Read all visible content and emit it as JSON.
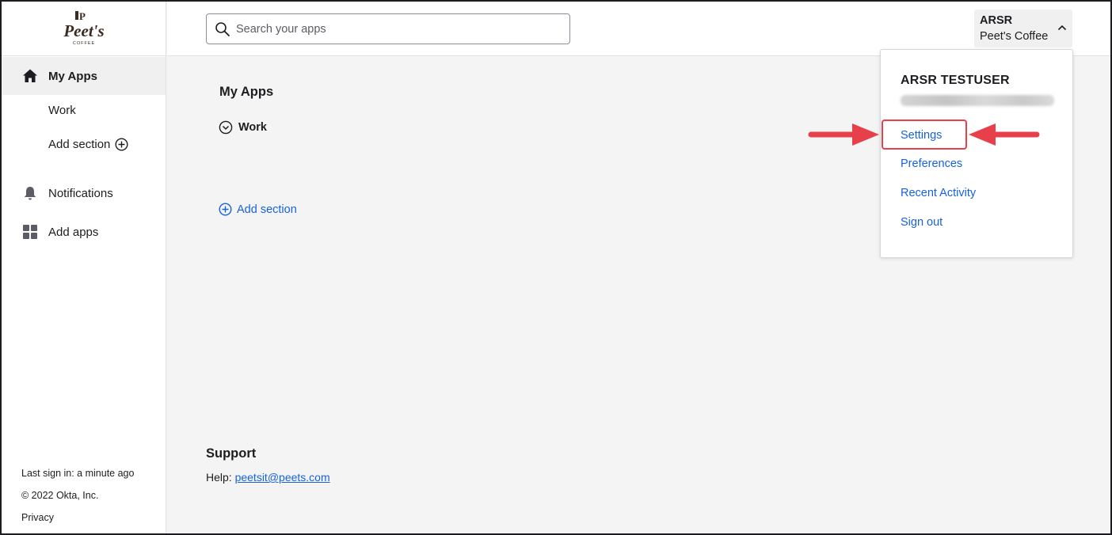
{
  "brand": {
    "logo_top": "P",
    "logo_main": "Peet's",
    "logo_sub": "COFFEE"
  },
  "sidebar": {
    "nav": [
      {
        "label": "My Apps",
        "icon": "home-icon",
        "active": true
      },
      {
        "label": "Notifications",
        "icon": "bell-icon",
        "active": false
      },
      {
        "label": "Add apps",
        "icon": "grid-icon",
        "active": false
      }
    ],
    "sections": [
      {
        "label": "Work"
      },
      {
        "label": "Add section",
        "icon": "plus-circle-icon"
      }
    ],
    "footer": {
      "last_sign_in": "Last sign in: a minute ago",
      "copyright": "© 2022 Okta, Inc.",
      "privacy": "Privacy"
    }
  },
  "header": {
    "search": {
      "placeholder": "Search your apps",
      "value": "",
      "icon": "search-icon"
    },
    "user": {
      "short_name": "ARSR",
      "org": "Peet's Coffee",
      "icon": "chevron-up-icon"
    }
  },
  "main": {
    "title": "My Apps",
    "section": {
      "label": "Work",
      "icon": "chevron-down-circle-icon"
    },
    "add_section": {
      "label": "Add section",
      "icon": "plus-circle-icon"
    },
    "support": {
      "title": "Support",
      "help_prefix": "Help: ",
      "help_email": "peetsit@peets.com"
    }
  },
  "dropdown": {
    "name": "ARSR TESTUSER",
    "links": [
      "Settings",
      "Preferences",
      "Recent Activity",
      "Sign out"
    ]
  },
  "colors": {
    "link": "#1662dd",
    "highlight": "#e8404a",
    "text": "#1d1d21",
    "background": "#f4f4f4"
  }
}
